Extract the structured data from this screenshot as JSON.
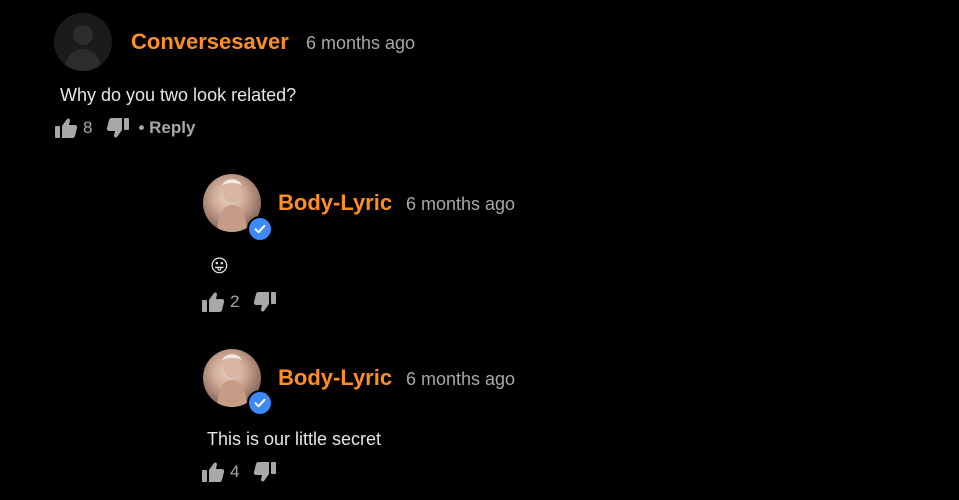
{
  "comments": [
    {
      "username": "Conversesaver",
      "timestamp": "6 months ago",
      "text": "Why do you two look related?",
      "likes": "8",
      "reply_label": "• Reply",
      "avatar": "default-user-avatar",
      "verified": false
    },
    {
      "username": "Body-Lyric",
      "timestamp": "6 months ago",
      "text": "😛",
      "likes": "2",
      "avatar": "profile-photo",
      "verified": true
    },
    {
      "username": "Body-Lyric",
      "timestamp": "6 months ago",
      "text": "This is our little secret",
      "likes": "4",
      "avatar": "profile-photo",
      "verified": true
    }
  ],
  "icons": {
    "like": "thumbs-up-icon",
    "dislike": "thumbs-down-icon",
    "verified": "verified-check-icon"
  },
  "colors": {
    "background": "#000000",
    "username": "#ff8f1f",
    "muted": "#a8a8a8",
    "body_text": "#e6e6e6",
    "verified_badge": "#3d8af7"
  }
}
